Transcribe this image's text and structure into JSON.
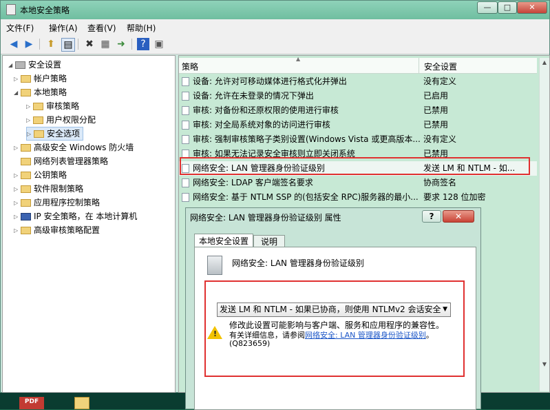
{
  "window": {
    "title": "本地安全策略",
    "min_label": "—",
    "max_label": "□",
    "close_label": "✕"
  },
  "menu": [
    "文件(F)",
    "操作(A)",
    "查看(V)",
    "帮助(H)"
  ],
  "tree": [
    {
      "label": "安全设置"
    },
    {
      "label": "帐户策略"
    },
    {
      "label": "本地策略"
    },
    {
      "label": "审核策略"
    },
    {
      "label": "用户权限分配"
    },
    {
      "label": "安全选项"
    },
    {
      "label": "高级安全 Windows 防火墙"
    },
    {
      "label": "网络列表管理器策略"
    },
    {
      "label": "公钥策略"
    },
    {
      "label": "软件限制策略"
    },
    {
      "label": "应用程序控制策略"
    },
    {
      "label": "IP 安全策略，在 本地计算机"
    },
    {
      "label": "高级审核策略配置"
    }
  ],
  "list": {
    "header_policy": "策略",
    "header_setting": "安全设置",
    "rows": [
      {
        "policy": "设备: 允许对可移动媒体进行格式化并弹出",
        "setting": "没有定义"
      },
      {
        "policy": "设备: 允许在未登录的情况下弹出",
        "setting": "已启用"
      },
      {
        "policy": "审核: 对备份和还原权限的使用进行审核",
        "setting": "已禁用"
      },
      {
        "policy": "审核: 对全局系统对象的访问进行审核",
        "setting": "已禁用"
      },
      {
        "policy": "审核: 强制审核策略子类别设置(Windows Vista 或更高版本...",
        "setting": "没有定义"
      },
      {
        "policy": "审核: 如果无法记录安全审核则立即关闭系统",
        "setting": "已禁用"
      },
      {
        "policy": "网络安全: LAN 管理器身份验证级别",
        "setting": "发送 LM 和 NTLM - 如..."
      },
      {
        "policy": "网络安全: LDAP 客户端签名要求",
        "setting": "协商签名"
      },
      {
        "policy": "网络安全: 基于 NTLM SSP 的(包括安全 RPC)服务器的最小...",
        "setting": "要求 128 位加密"
      }
    ]
  },
  "dialog": {
    "title": "网络安全: LAN 管理器身份验证级别 属性",
    "help_label": "?",
    "close_label": "✕",
    "tabs": [
      "本地安全设置",
      "说明"
    ],
    "policy_name": "网络安全: LAN 管理器身份验证级别",
    "selected_value": "发送 LM 和 NTLM - 如果已协商，则使用 NTLMv2 会话安全",
    "warning_line1": "修改此设置可能影响与客户端、服务和应用程序的兼容性。",
    "warning_line2_prefix": "有关详细信息，请参阅",
    "warning_link": "网络安全: LAN 管理器身份验证级别",
    "warning_line2_suffix": "。",
    "warning_line3": "(Q823659)"
  },
  "desktop": {
    "pdf_label": "PDF"
  }
}
